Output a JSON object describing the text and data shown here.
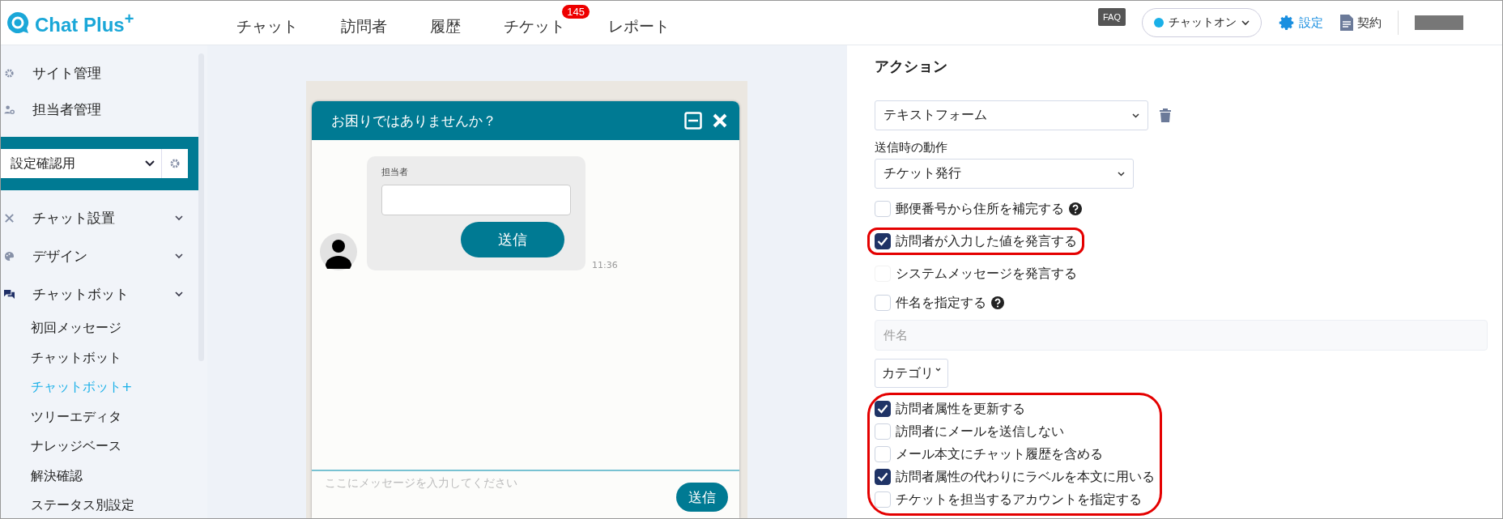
{
  "header": {
    "logo": "Chat Plus$^{+}$",
    "nav": [
      {
        "label": "チャット"
      },
      {
        "label": "訪問者"
      },
      {
        "label": "履歴"
      },
      {
        "label": "チケット",
        "badge": "145"
      },
      {
        "label": "レポート"
      }
    ],
    "faq": "FAQ",
    "status": {
      "label": "チャットオン",
      "on": true
    },
    "settings": "設定",
    "contract": "契約"
  },
  "sidebar": {
    "top_items": [
      {
        "label": "サイト管理"
      },
      {
        "label": "担当者管理"
      }
    ],
    "site_select": "設定確認用",
    "menu": [
      {
        "label": "チャット設置",
        "expanded": false
      },
      {
        "label": "デザイン",
        "expanded": false
      },
      {
        "label": "チャットボット",
        "expanded": true,
        "children": [
          {
            "label": "初回メッセージ",
            "selected": false
          },
          {
            "label": "チャットボット",
            "selected": false
          },
          {
            "label": "チャットボット+",
            "selected": true
          },
          {
            "label": "ツリーエディタ",
            "selected": false
          },
          {
            "label": "ナレッジベース",
            "selected": false
          },
          {
            "label": "解決確認",
            "selected": false
          },
          {
            "label": "ステータス別設定",
            "selected": false
          }
        ]
      }
    ]
  },
  "chat_preview": {
    "title": "お困りではありませんか？",
    "form_label": "担当者",
    "form_button": "送信",
    "time": "11:36",
    "input_placeholder": "ここにメッセージを入力してください",
    "send_button": "送信"
  },
  "action_panel": {
    "title": "アクション",
    "action_type": "テキストフォーム",
    "on_send_label": "送信時の動作",
    "on_send_value": "チケット発行",
    "groups_before": [
      {
        "highlighted": false,
        "items": [
          {
            "label": "郵便番号から住所を補完する",
            "checked": false,
            "disabled": false,
            "help": true
          }
        ]
      },
      {
        "highlighted": true,
        "items": [
          {
            "label": "訪問者が入力した値を発言する",
            "checked": true,
            "disabled": false,
            "help": false
          }
        ]
      },
      {
        "highlighted": false,
        "items": [
          {
            "label": "システムメッセージを発言する",
            "checked": false,
            "disabled": true,
            "help": false
          },
          {
            "label": "件名を指定する",
            "checked": false,
            "disabled": false,
            "help": true
          }
        ]
      }
    ],
    "subject_placeholder": "件名",
    "category": "カテゴリ",
    "groups_after": [
      {
        "highlighted": true,
        "items": [
          {
            "label": "訪問者属性を更新する",
            "checked": true,
            "disabled": false,
            "help": false
          },
          {
            "label": "訪問者にメールを送信しない",
            "checked": false,
            "disabled": false,
            "help": false
          },
          {
            "label": "メール本文にチャット履歴を含める",
            "checked": false,
            "disabled": false,
            "help": false
          },
          {
            "label": "訪問者属性の代わりにラベルを本文に用いる",
            "checked": true,
            "disabled": false,
            "help": false
          },
          {
            "label": "チケットを担当するアカウントを指定する",
            "checked": false,
            "disabled": false,
            "help": false
          }
        ]
      }
    ]
  }
}
